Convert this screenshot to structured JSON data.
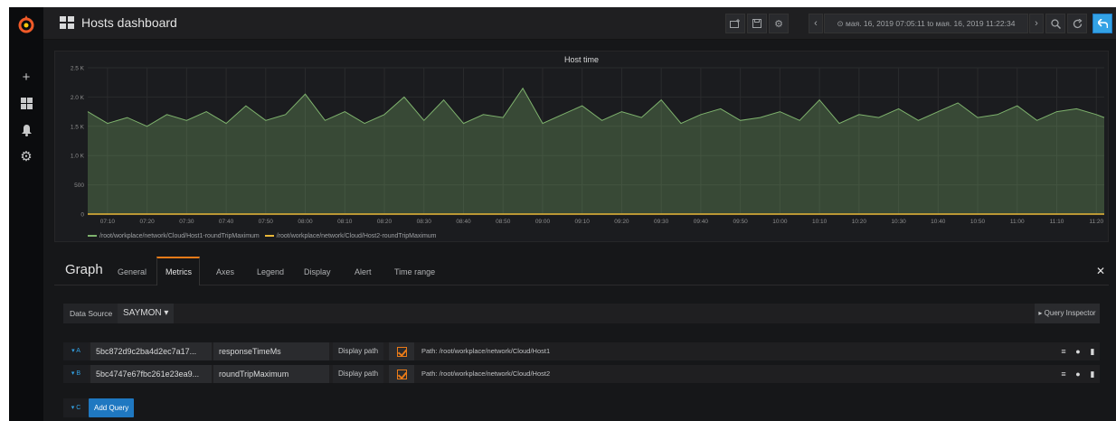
{
  "dashboard": {
    "title": "Hosts dashboard"
  },
  "sidebar": {
    "items": [
      {
        "icon": "plus-icon",
        "glyph": "+"
      },
      {
        "icon": "dashboards-icon",
        "glyph": "▦"
      },
      {
        "icon": "alert-bell-icon",
        "glyph": "🔔"
      },
      {
        "icon": "gear-icon",
        "glyph": "⚙"
      }
    ]
  },
  "toolbar": {
    "time_range": "⊙ мая. 16, 2019 07:05:11 to мая. 16, 2019 11:22:34",
    "prev": "‹",
    "next": "›"
  },
  "panel": {
    "title": "Host time",
    "legend": [
      {
        "label": "/root/workplace/network/Cloud/Host1-roundTripMaximum",
        "color": "#7eb26d"
      },
      {
        "label": "/root/workplace/network/Cloud/Host2-roundTripMaximum",
        "color": "#eab839"
      }
    ]
  },
  "chart_data": {
    "type": "area",
    "title": "Host time",
    "x_ticks": [
      "07:10",
      "07:20",
      "07:30",
      "07:40",
      "07:50",
      "08:00",
      "08:10",
      "08:20",
      "08:30",
      "08:40",
      "08:50",
      "09:00",
      "09:10",
      "09:20",
      "09:30",
      "09:40",
      "09:50",
      "10:00",
      "10:10",
      "10:20",
      "10:30",
      "10:40",
      "10:50",
      "11:00",
      "11:10",
      "11:20"
    ],
    "y_ticks": [
      "0",
      "500",
      "1.0 K",
      "1.5 K",
      "2.0 K",
      "2.5 K"
    ],
    "ylim": [
      0,
      2500
    ],
    "grid": true,
    "legend_position": "bottom-left",
    "series": [
      {
        "name": "/root/workplace/network/Cloud/Host1-roundTripMaximum",
        "color": "#7eb26d",
        "x": [
          "07:05",
          "07:10",
          "07:15",
          "07:20",
          "07:25",
          "07:30",
          "07:35",
          "07:40",
          "07:45",
          "07:50",
          "07:55",
          "08:00",
          "08:05",
          "08:10",
          "08:15",
          "08:20",
          "08:25",
          "08:30",
          "08:35",
          "08:40",
          "08:45",
          "08:50",
          "08:55",
          "09:00",
          "09:05",
          "09:10",
          "09:15",
          "09:20",
          "09:25",
          "09:30",
          "09:35",
          "09:40",
          "09:45",
          "09:50",
          "09:55",
          "10:00",
          "10:05",
          "10:10",
          "10:15",
          "10:20",
          "10:25",
          "10:30",
          "10:35",
          "10:40",
          "10:45",
          "10:50",
          "10:55",
          "11:00",
          "11:05",
          "11:10",
          "11:15",
          "11:20",
          "11:22"
        ],
        "values": [
          1750,
          1550,
          1650,
          1500,
          1700,
          1600,
          1750,
          1550,
          1850,
          1600,
          1700,
          2050,
          1600,
          1750,
          1550,
          1700,
          2000,
          1600,
          1950,
          1550,
          1700,
          1650,
          2150,
          1550,
          1700,
          1850,
          1600,
          1750,
          1650,
          1950,
          1550,
          1700,
          1800,
          1600,
          1650,
          1750,
          1600,
          1950,
          1550,
          1700,
          1650,
          1800,
          1600,
          1750,
          1900,
          1650,
          1700,
          1850,
          1600,
          1750,
          1800,
          1700,
          1650
        ]
      },
      {
        "name": "/root/workplace/network/Cloud/Host2-roundTripMaximum",
        "color": "#eab839",
        "x": [
          "07:05",
          "11:22"
        ],
        "values": [
          0,
          0
        ]
      }
    ]
  },
  "editor": {
    "title": "Graph",
    "tabs": [
      "General",
      "Metrics",
      "Axes",
      "Legend",
      "Display",
      "Alert",
      "Time range"
    ],
    "active_tab": "Metrics",
    "close": "✕"
  },
  "datasource": {
    "label": "Data Source",
    "value": "SAYMON ▾",
    "inspector": "▸ Query Inspector"
  },
  "queries": [
    {
      "letter": "▾ A",
      "id": "5bc872d9c2ba4d2ec7a17...",
      "metric": "responseTimeMs",
      "tag": "Display path",
      "path": "Path: /root/workplace/network/Cloud/Host1"
    },
    {
      "letter": "▾ B",
      "id": "5bc4747e67fbc261e23ea9...",
      "metric": "roundTripMaximum",
      "tag": "Display path",
      "path": "Path: /root/workplace/network/Cloud/Host2"
    }
  ],
  "add_query": {
    "letter": "▾ C",
    "label": "Add Query"
  }
}
